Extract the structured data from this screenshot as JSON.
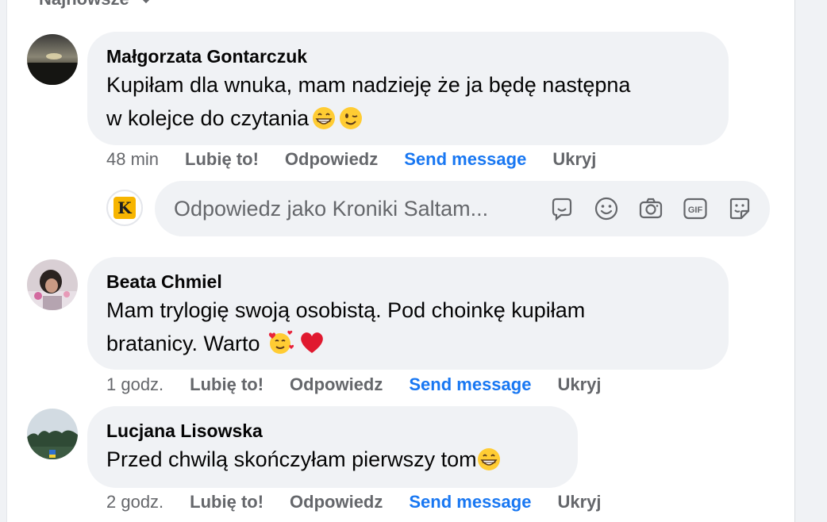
{
  "sort": {
    "label": "Najnowsze"
  },
  "comments": [
    {
      "author": "Małgorzata Gontarczuk",
      "line1": "Kupiłam dla wnuka, mam nadzieję że ja będę następna",
      "line2": "w kolejce do czytania",
      "time": "48 min",
      "like": "Lubię to!",
      "reply": "Odpowiedz",
      "send": "Send message",
      "hide": "Ukryj"
    },
    {
      "author": "Beata Chmiel",
      "line1": "Mam trylogię swoją osobistą. Pod choinkę kupiłam",
      "line2": "bratanicy. Warto",
      "time": "1 godz.",
      "like": "Lubię to!",
      "reply": "Odpowiedz",
      "send": "Send message",
      "hide": "Ukryj"
    },
    {
      "author": "Lucjana Lisowska",
      "line1": "Przed chwilą skończyłam pierwszy tom",
      "time": "2 godz.",
      "like": "Lubię to!",
      "reply": "Odpowiedz",
      "send": "Send message",
      "hide": "Ukryj"
    }
  ],
  "reply_box": {
    "page_initial": "K",
    "placeholder": "Odpowiedz jako Kroniki Saltam..."
  },
  "icons": [
    "chevron-down-icon",
    "avatar-icon",
    "chat-bubble-icon",
    "smiley-icon",
    "camera-icon",
    "gif-icon",
    "sticker-icon",
    "grinning-emoji",
    "winking-emoji",
    "smiling-hearts-emoji",
    "red-heart-emoji"
  ],
  "colors": {
    "link": "#1877f2",
    "muted": "#65676b",
    "bubble": "#f0f2f5",
    "page_badge": "#f7b500"
  }
}
